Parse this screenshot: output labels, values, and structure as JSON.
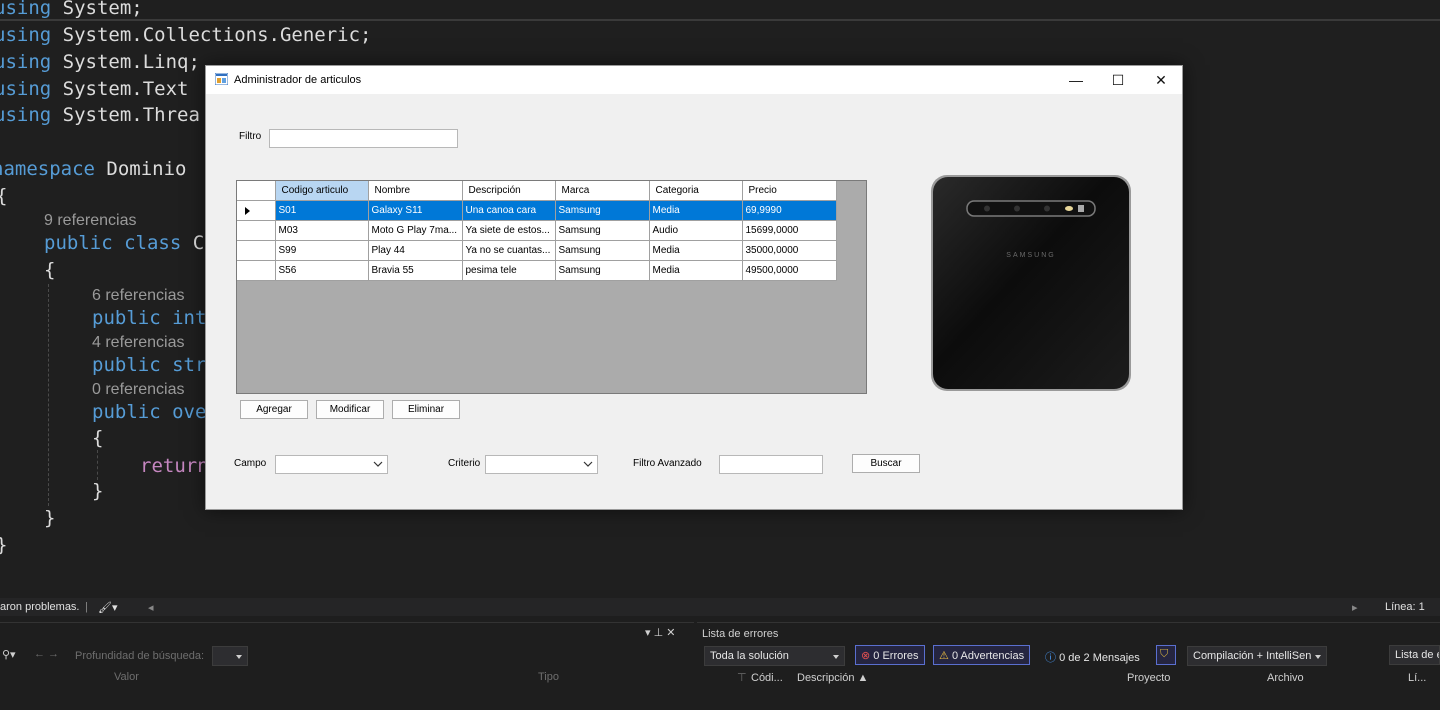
{
  "editor": {
    "lines": [
      {
        "kw": "using",
        "rest": " System;"
      },
      {
        "kw": "using",
        "rest": " System.Collections.Generic;"
      },
      {
        "kw": "using",
        "rest": " System.Linq;"
      },
      {
        "kw": "using",
        "rest": " System.Text"
      },
      {
        "kw": "using",
        "rest": " System.Threa"
      }
    ],
    "namespace_kw": "namespace",
    "namespace_name": " Dominio",
    "brace_open": "{",
    "brace_close": "}",
    "refs_class": "9 referencias",
    "class_line_kw": "public class",
    "class_line_rest": " C",
    "refs_1": "6 referencias",
    "prop_1_kw": "public",
    "prop_1_rest": " int",
    "refs_2": "4 referencias",
    "prop_2_kw": "public",
    "prop_2_rest": " str",
    "refs_3": "0 referencias",
    "prop_3_kw": "public",
    "prop_3_rest": " ove",
    "return_kw": "return"
  },
  "status": {
    "problems": "aron problemas.",
    "line": "Línea: 1"
  },
  "left_panel": {
    "pin": "▾ ⊥ ✕",
    "depth_label": "Profundidad de búsqueda:",
    "col_value": "Valor",
    "col_type": "Tipo"
  },
  "error_list": {
    "title": "Lista de errores",
    "scope": "Toda la solución",
    "errors": "0 Errores",
    "warnings": "0 Advertencias",
    "messages": "0 de 2 Mensajes",
    "build": "Compilación + IntelliSen",
    "search": "Lista de e",
    "columns": [
      "Códi...",
      "Descripción",
      "Proyecto",
      "Archivo",
      "Lí..."
    ]
  },
  "window": {
    "title": "Administrador de articulos",
    "minimize": "—",
    "maximize": "☐",
    "close": "✕",
    "filter_label": "Filtro",
    "filter_value": "",
    "grid": {
      "columns": [
        "Codigo articulo",
        "Nombre",
        "Descripción",
        "Marca",
        "Categoria",
        "Precio"
      ],
      "rows": [
        [
          "S01",
          "Galaxy S11",
          "Una canoa cara",
          "Samsung",
          "Media",
          "69,9990"
        ],
        [
          "M03",
          "Moto G Play 7ma...",
          "Ya siete de estos...",
          "Samsung",
          "Audio",
          "15699,0000"
        ],
        [
          "S99",
          "Play 44",
          "Ya no se cuantas...",
          "Samsung",
          "Media",
          "35000,0000"
        ],
        [
          "S56",
          "Bravia 55",
          "pesima tele",
          "Samsung",
          "Media",
          "49500,0000"
        ]
      ],
      "selected_row": 0
    },
    "buttons": {
      "add": "Agregar",
      "edit": "Modificar",
      "delete": "Eliminar",
      "search": "Buscar"
    },
    "advanced": {
      "field_label": "Campo",
      "criteria_label": "Criterio",
      "adv_filter_label": "Filtro Avanzado",
      "adv_filter_value": ""
    },
    "phone_brand": "SAMSUNG"
  },
  "colors": {
    "selection": "#0078d7",
    "header_selected": "#b8d6f2",
    "editor_bg": "#1f1f1f",
    "keyword": "#569cd6"
  }
}
